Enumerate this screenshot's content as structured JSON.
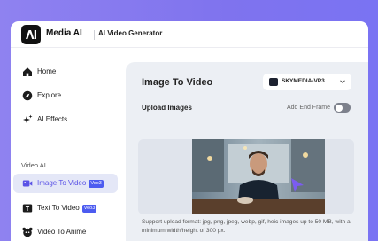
{
  "header": {
    "brand": "Media AI",
    "app_title": "AI Video Generator"
  },
  "sidebar": {
    "items": [
      {
        "label": "Home",
        "icon": "home-icon"
      },
      {
        "label": "Explore",
        "icon": "compass-icon"
      },
      {
        "label": "AI Effects",
        "icon": "sparkle-icon"
      }
    ],
    "section_label": "Video AI",
    "video_items": [
      {
        "label": "Image To Video",
        "badge": "Veo3",
        "icon": "image-video-icon",
        "active": true
      },
      {
        "label": "Text To Video",
        "badge": "Veo3",
        "icon": "text-video-icon"
      },
      {
        "label": "Video To Anime",
        "icon": "anime-icon"
      }
    ]
  },
  "main": {
    "title": "Image To Video",
    "model_select": {
      "value": "SKYMEDIA-VP3"
    },
    "upload_label": "Upload Images",
    "end_frame_label": "Add End Frame",
    "end_frame_enabled": false,
    "support_text": "Support upload format: jpg, png, jpeg, webp, gif, heic images up to 50 MB, with a minimum width/height of 300 px."
  },
  "colors": {
    "background": "#8f82f0",
    "accent": "#5a52e6",
    "badge": "#4c5bf0",
    "cursor": "#7b5cf0"
  }
}
